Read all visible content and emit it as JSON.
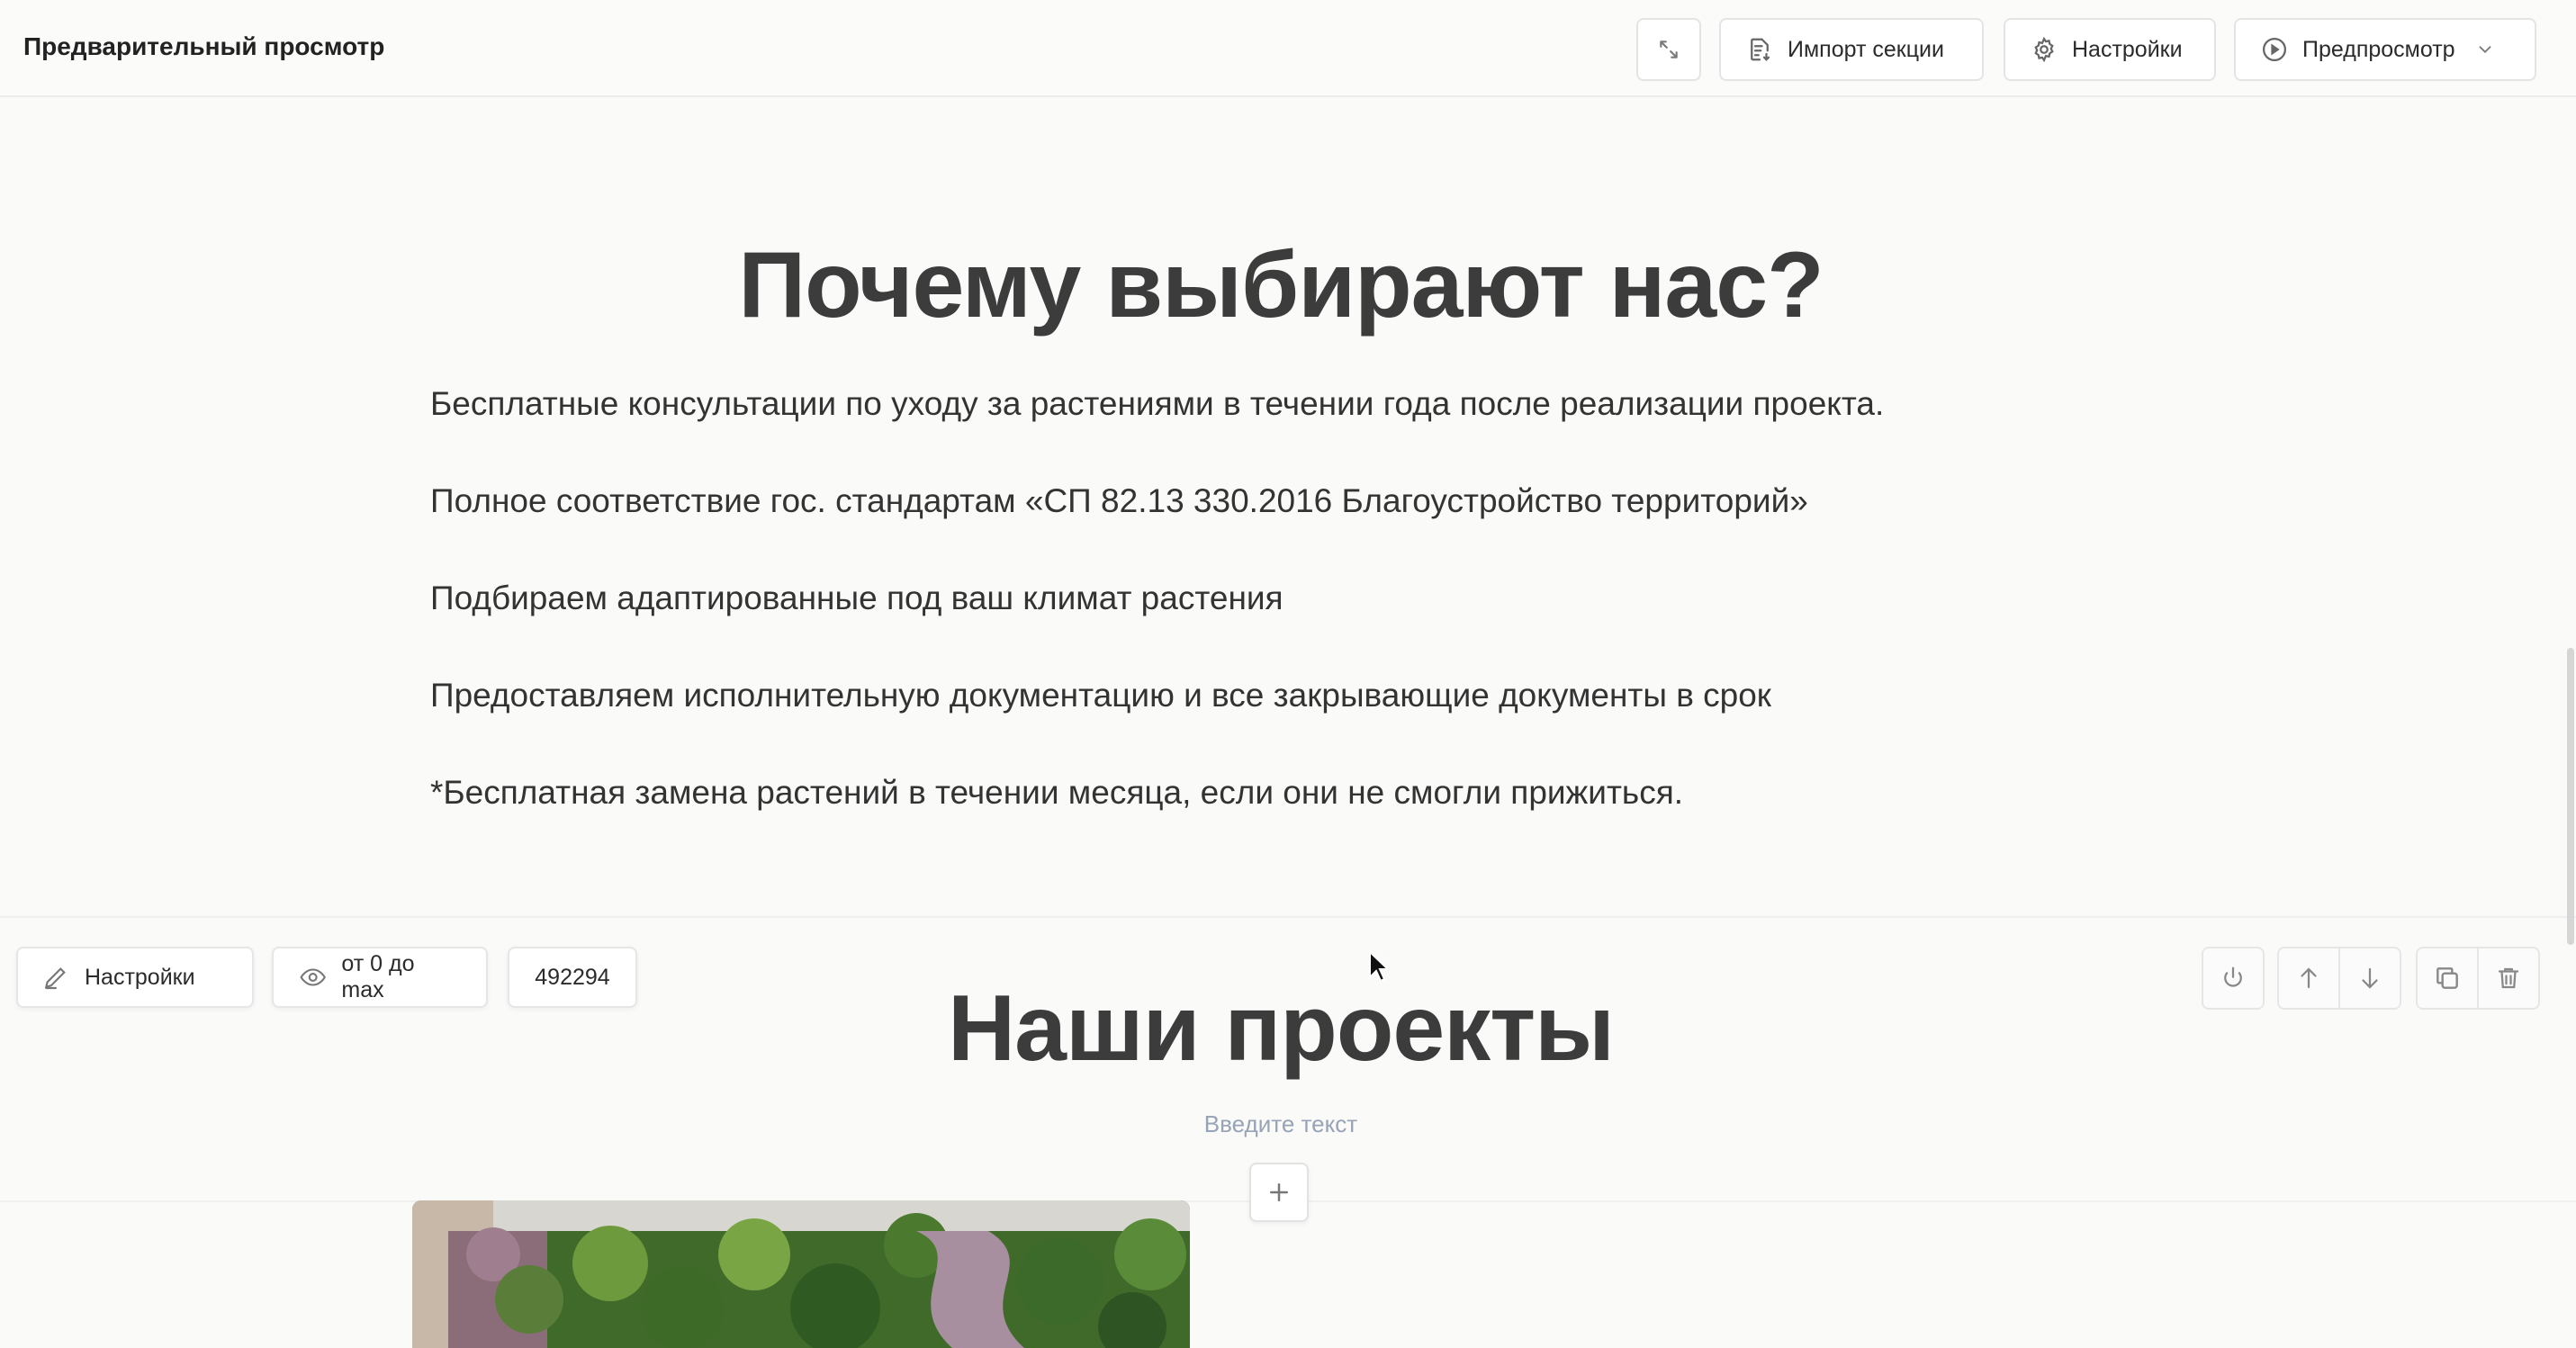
{
  "topbar": {
    "title": "Предварительный просмотр",
    "import_label": "Импорт секции",
    "settings_label": "Настройки",
    "preview_label": "Предпросмотр"
  },
  "section_why": {
    "title": "Почему выбирают нас?",
    "features": [
      "Бесплатные консультации по уходу за растениями в течении года после реализации проекта.",
      "Полное соответствие гос. стандартам «СП 82.13 330.2016 Благоустройство территорий»",
      "Подбираем адаптированные под ваш климат растения",
      "Предоставляем исполнительную документацию и все закрывающие документы в срок",
      "*Бесплатная замена растений в течении месяца, если они не смогли прижиться."
    ]
  },
  "section_controls": {
    "settings_label": "Настройки",
    "visibility_label": "от 0 до max",
    "section_id": "492294"
  },
  "section_projects": {
    "title": "Наши проекты",
    "text_placeholder": "Введите текст"
  },
  "icons": {
    "expand": "expand-icon",
    "import": "document-import-icon",
    "settings": "gear-icon",
    "preview": "play-circle-icon",
    "dropdown": "chevron-down-icon",
    "edit": "pencil-icon",
    "visibility": "eye-icon",
    "power": "power-icon",
    "move_up": "arrow-up-icon",
    "move_down": "arrow-down-icon",
    "duplicate": "copy-icon",
    "delete": "trash-icon",
    "add": "plus-icon"
  },
  "colors": {
    "background": "#fafaf8",
    "heading": "#3c3c3c",
    "placeholder": "#97a3b6",
    "border": "#e4e4e4"
  }
}
